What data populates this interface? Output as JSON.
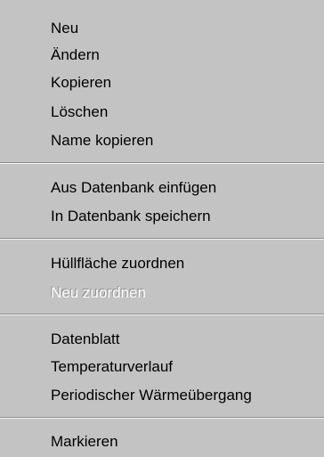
{
  "menu": {
    "groups": [
      {
        "items": [
          {
            "label": "Neu",
            "enabled": true
          },
          {
            "label": "Ändern",
            "enabled": true
          },
          {
            "label": "Kopieren",
            "enabled": true
          },
          {
            "label": "Löschen",
            "enabled": true
          },
          {
            "label": "Name kopieren",
            "enabled": true
          }
        ]
      },
      {
        "items": [
          {
            "label": "Aus Datenbank einfügen",
            "enabled": true
          },
          {
            "label": "In Datenbank speichern",
            "enabled": true
          }
        ]
      },
      {
        "items": [
          {
            "label": "Hüllfläche zuordnen",
            "enabled": true
          },
          {
            "label": "Neu zuordnen",
            "enabled": false
          }
        ]
      },
      {
        "items": [
          {
            "label": "Datenblatt",
            "enabled": true
          },
          {
            "label": "Temperaturverlauf",
            "enabled": true
          },
          {
            "label": "Periodischer Wärmeübergang",
            "enabled": true
          }
        ]
      },
      {
        "items": [
          {
            "label": "Markieren",
            "enabled": true
          }
        ]
      }
    ]
  }
}
